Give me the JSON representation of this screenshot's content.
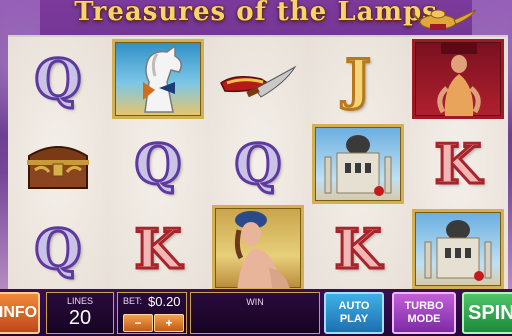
{
  "game": {
    "title": "Treasures of the Lamps"
  },
  "reels": [
    [
      {
        "symbol": "Q",
        "kind": "letter-q"
      },
      {
        "symbol": "treasure-chest",
        "kind": "image"
      },
      {
        "symbol": "Q",
        "kind": "letter-q"
      }
    ],
    [
      {
        "symbol": "white-horse",
        "kind": "image"
      },
      {
        "symbol": "Q",
        "kind": "letter-q"
      },
      {
        "symbol": "K",
        "kind": "letter-k"
      }
    ],
    [
      {
        "symbol": "dagger",
        "kind": "image"
      },
      {
        "symbol": "Q",
        "kind": "letter-q"
      },
      {
        "symbol": "princess",
        "kind": "image-tall"
      }
    ],
    [
      {
        "symbol": "J",
        "kind": "letter-j"
      },
      {
        "symbol": "palace",
        "kind": "image"
      },
      {
        "symbol": "K",
        "kind": "letter-k"
      }
    ],
    [
      {
        "symbol": "dancer",
        "kind": "image"
      },
      {
        "symbol": "K",
        "kind": "letter-k"
      },
      {
        "symbol": "palace",
        "kind": "image"
      }
    ]
  ],
  "controls": {
    "info_label": "INFO",
    "lines_label": "LINES",
    "lines_value": "20",
    "bet_label": "BET:",
    "bet_value": "$0.20",
    "bet_minus": "−",
    "bet_plus": "+",
    "win_label": "WIN",
    "auto_play_line1": "AUTO",
    "auto_play_line2": "PLAY",
    "turbo_line1": "TURBO",
    "turbo_line2": "MODE",
    "spin_label": "SPIN"
  },
  "colors": {
    "background": "#7c3a9b",
    "reel_bg": "#efe9e3",
    "gold_frame": "#d3b056",
    "spin_green": "#1d8a3a",
    "auto_blue": "#1d70b0",
    "turbo_purple": "#7d2aa6",
    "info_orange": "#c0461c"
  }
}
